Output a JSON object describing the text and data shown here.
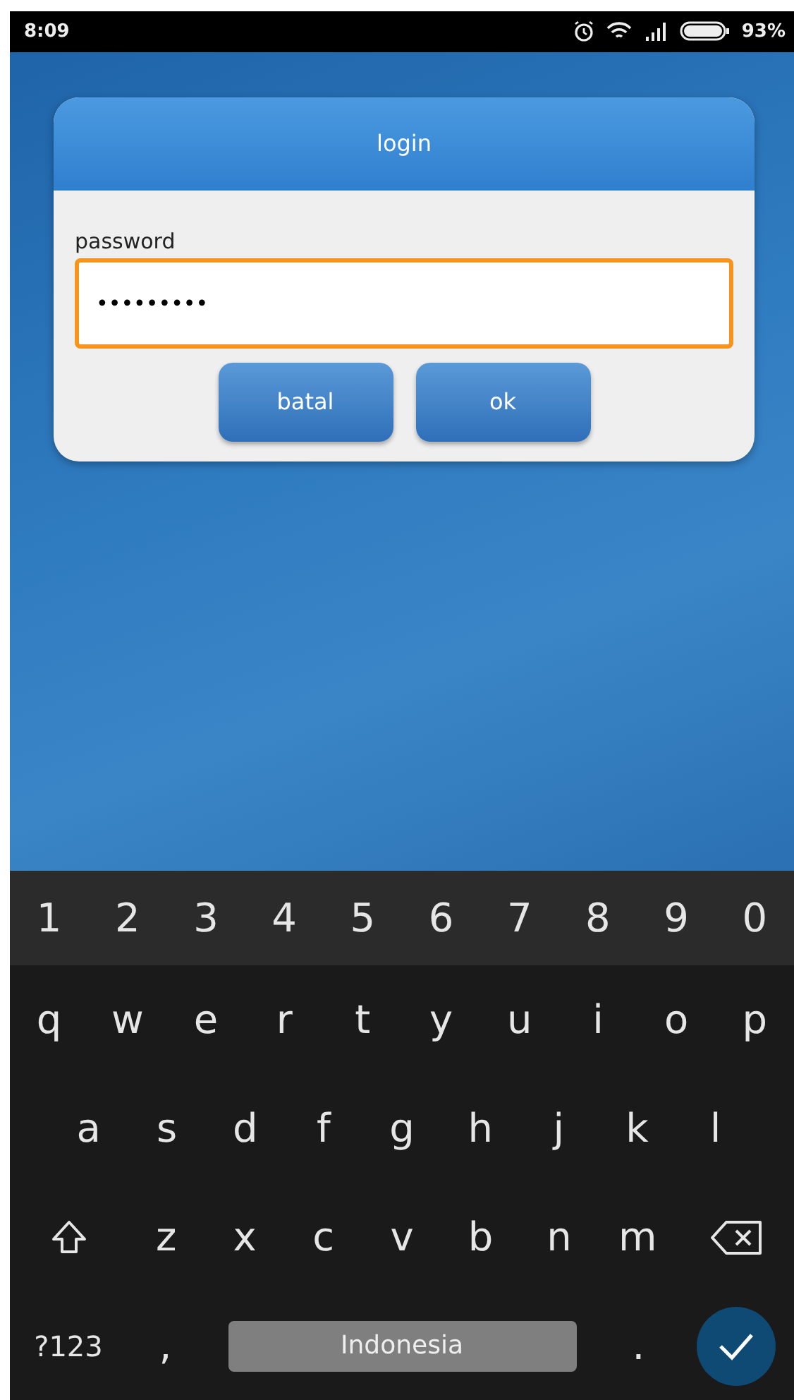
{
  "status_bar": {
    "time": "8:09",
    "battery": "93%"
  },
  "dialog": {
    "title": "login",
    "field": {
      "label": "password",
      "value": "•••••••••",
      "focused": true
    },
    "buttons": [
      "batal",
      "ok"
    ]
  },
  "keyboard": {
    "number_row": [
      "1",
      "2",
      "3",
      "4",
      "5",
      "6",
      "7",
      "8",
      "9",
      "0"
    ],
    "rows": [
      [
        {
          "kind": "letter",
          "label": "q"
        },
        {
          "kind": "letter",
          "label": "w"
        },
        {
          "kind": "letter",
          "label": "e"
        },
        {
          "kind": "letter",
          "label": "r"
        },
        {
          "kind": "letter",
          "label": "t"
        },
        {
          "kind": "letter",
          "label": "y"
        },
        {
          "kind": "letter",
          "label": "u"
        },
        {
          "kind": "letter",
          "label": "i"
        },
        {
          "kind": "letter",
          "label": "o"
        },
        {
          "kind": "letter",
          "label": "p"
        }
      ],
      [
        {
          "kind": "letter",
          "label": "a"
        },
        {
          "kind": "letter",
          "label": "s"
        },
        {
          "kind": "letter",
          "label": "d"
        },
        {
          "kind": "letter",
          "label": "f"
        },
        {
          "kind": "letter",
          "label": "g"
        },
        {
          "kind": "letter",
          "label": "h"
        },
        {
          "kind": "letter",
          "label": "j"
        },
        {
          "kind": "letter",
          "label": "k"
        },
        {
          "kind": "letter",
          "label": "l"
        }
      ],
      [
        {
          "kind": "shift"
        },
        {
          "kind": "letter",
          "label": "z"
        },
        {
          "kind": "letter",
          "label": "x"
        },
        {
          "kind": "letter",
          "label": "c"
        },
        {
          "kind": "letter",
          "label": "v"
        },
        {
          "kind": "letter",
          "label": "b"
        },
        {
          "kind": "letter",
          "label": "n"
        },
        {
          "kind": "letter",
          "label": "m"
        },
        {
          "kind": "backspace"
        }
      ]
    ],
    "bottom_bar": {
      "symbols_key": "?123",
      "comma_key": ",",
      "space_bar": "Indonesia",
      "period_key": "."
    }
  }
}
